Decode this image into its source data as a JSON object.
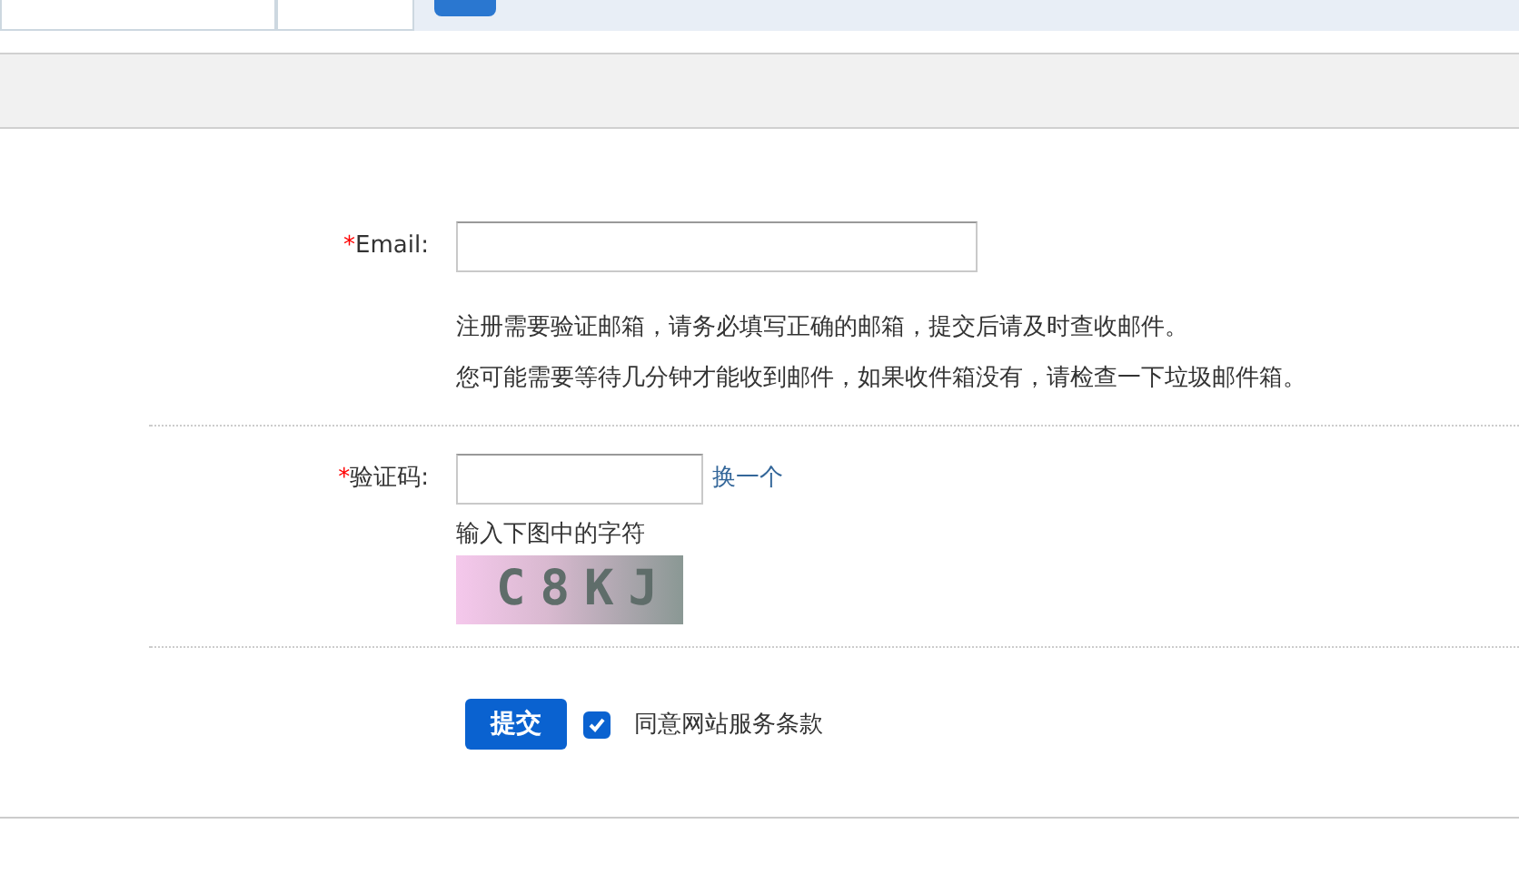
{
  "top_bar": {
    "fields": [
      {
        "kind": "input"
      },
      {
        "kind": "input"
      }
    ]
  },
  "form": {
    "email": {
      "required_mark": "*",
      "label": "Email:",
      "hints": [
        "注册需要验证邮箱，请务必填写正确的邮箱，提交后请及时查收邮件。",
        "您可能需要等待几分钟才能收到邮件，如果收件箱没有，请检查一下垃圾邮件箱。"
      ]
    },
    "captcha": {
      "required_mark": "*",
      "label": "验证码:",
      "refresh_link": "换一个",
      "hint": "输入下图中的字符",
      "image_text": "C8KJ"
    },
    "submit_button": "提交",
    "agree": {
      "label": "同意网站服务条款",
      "checked": true
    }
  }
}
